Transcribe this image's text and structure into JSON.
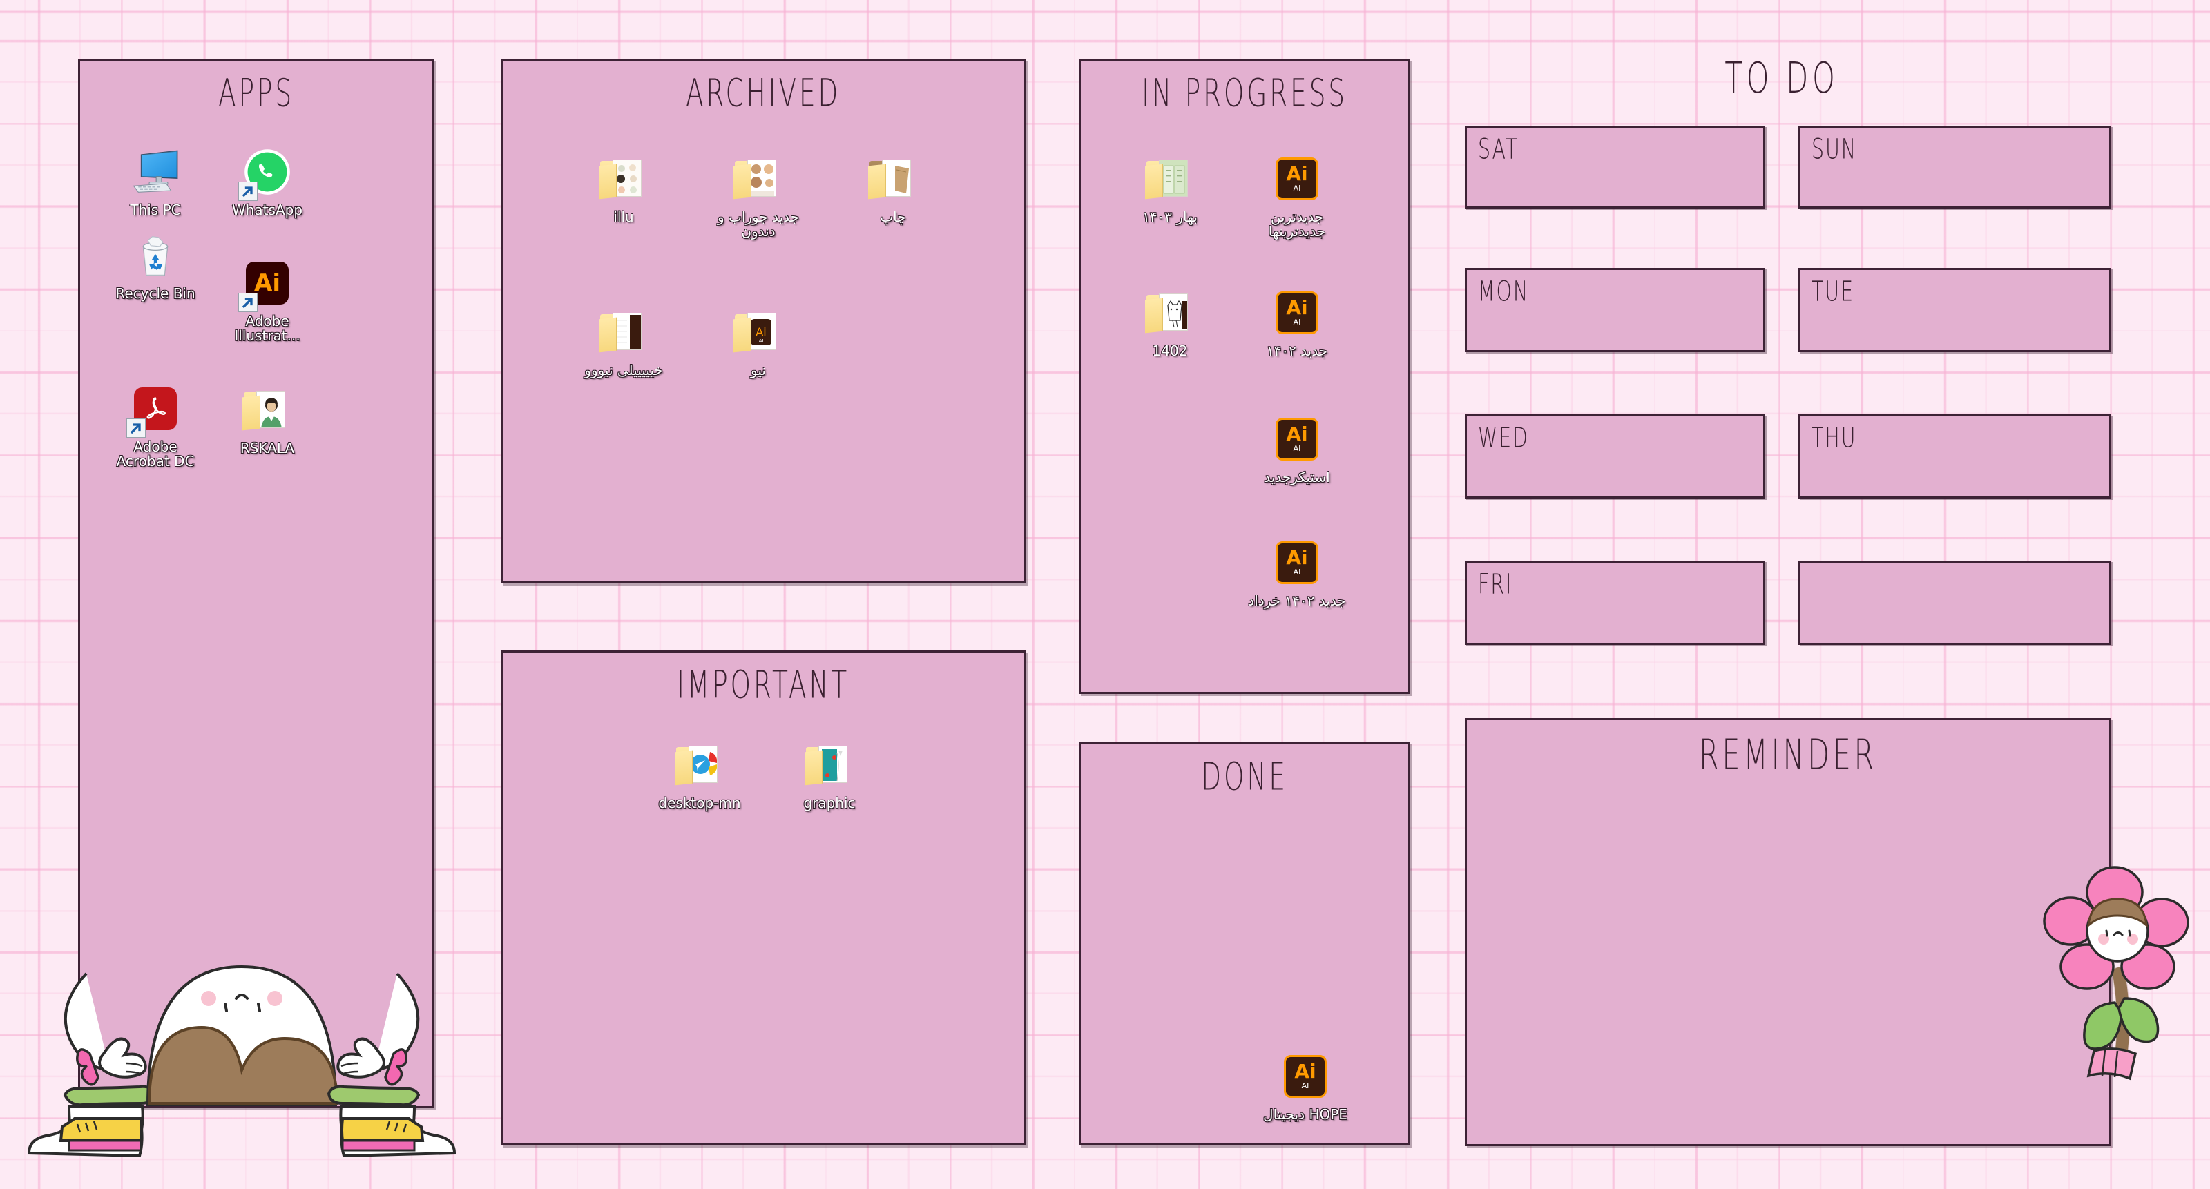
{
  "wallpaper": {
    "background_color": "#fdeaf4",
    "grid_color": "#f7b2d4",
    "panel_color": "#e3b0d0",
    "panel_border_color": "#3d2235"
  },
  "panels": {
    "apps": {
      "title": "APPS",
      "icons": [
        {
          "label": "This PC",
          "icon": "this-pc-icon",
          "shortcut": false
        },
        {
          "label": "WhatsApp",
          "icon": "whatsapp-icon",
          "shortcut": true
        },
        {
          "label": "Recycle Bin",
          "icon": "recycle-bin-icon",
          "shortcut": false
        },
        {
          "label": "Adobe Illustrat...",
          "icon": "adobe-illustrator-icon",
          "shortcut": true
        },
        {
          "label": "Adobe Acrobat DC",
          "icon": "adobe-acrobat-icon",
          "shortcut": true
        },
        {
          "label": "RSKALA",
          "icon": "user-folder-icon",
          "shortcut": false
        }
      ]
    },
    "archived": {
      "title": "ARCHIVED",
      "icons": [
        {
          "label": "illu",
          "icon": "folder-icon",
          "rtl": false
        },
        {
          "label": "جدید جوراب و دندون",
          "icon": "folder-icon",
          "rtl": true
        },
        {
          "label": "چاپ",
          "icon": "folder-icon",
          "rtl": true
        },
        {
          "label": "خیییییلی نیووو",
          "icon": "folder-icon",
          "rtl": true
        },
        {
          "label": "نیو",
          "icon": "folder-icon",
          "rtl": true
        }
      ]
    },
    "important": {
      "title": "IMPORTANT",
      "icons": [
        {
          "label": "desktop-mn",
          "icon": "folder-icon",
          "rtl": false
        },
        {
          "label": "graphic",
          "icon": "folder-icon",
          "rtl": false
        }
      ]
    },
    "in_progress": {
      "title": "IN PROGRESS",
      "icons": [
        {
          "label": "بهار ۱۴۰۳",
          "icon": "folder-icon",
          "rtl": true
        },
        {
          "label": "جدیدترین جدیدترینها",
          "icon": "ai-file-icon",
          "rtl": true
        },
        {
          "label": "1402",
          "icon": "folder-icon",
          "rtl": false
        },
        {
          "label": "جدید ۱۴۰۲",
          "icon": "ai-file-icon",
          "rtl": true
        },
        {
          "label": "استیکرجدید",
          "icon": "ai-file-icon",
          "rtl": true
        },
        {
          "label": "جدید ۱۴۰۲ خرداد",
          "icon": "ai-file-icon",
          "rtl": true
        }
      ]
    },
    "done": {
      "title": "DONE",
      "icons": [
        {
          "label": "HOPE دیجیتال",
          "icon": "ai-file-icon",
          "rtl": true
        }
      ]
    },
    "todo": {
      "title": "TO DO",
      "days": [
        {
          "label": "SAT"
        },
        {
          "label": "SUN"
        },
        {
          "label": "MON"
        },
        {
          "label": "TUE"
        },
        {
          "label": "WED"
        },
        {
          "label": "THU"
        },
        {
          "label": "FRI"
        },
        {
          "label": ""
        }
      ]
    },
    "reminder": {
      "title": "REMINDER",
      "body": ""
    }
  },
  "decorations": {
    "mascot": "bunny-character",
    "flower": "flower-character"
  }
}
